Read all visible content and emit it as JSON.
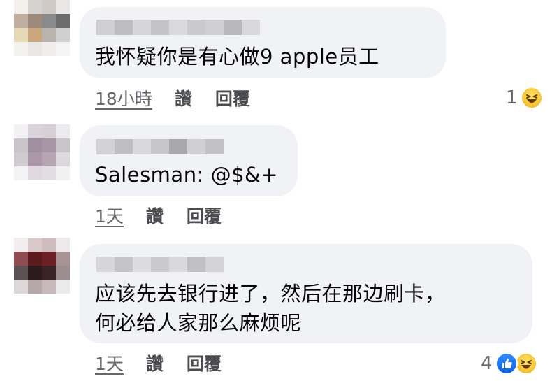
{
  "colors": {
    "bubble_bg": "#f0f2f5",
    "text": "#050505",
    "meta_text": "#65676b",
    "like_blue": "#1877f2",
    "haha_yellow": "#f7c633"
  },
  "comments": [
    {
      "text_lines": [
        "我怀疑你是有心做9 apple员工"
      ],
      "time": "18小時",
      "like_label": "讚",
      "reply_label": "回覆",
      "reaction_count": "1",
      "reactions": [
        "haha-icon"
      ]
    },
    {
      "text_lines": [
        "Salesman: @$&+"
      ],
      "time": "1天",
      "like_label": "讚",
      "reply_label": "回覆",
      "reaction_count": "",
      "reactions": []
    },
    {
      "text_lines": [
        "应该先去银行进了，然后在那边刷卡，",
        "何必给人家那么麻烦呢"
      ],
      "time": "1天",
      "like_label": "讚",
      "reply_label": "回覆",
      "reaction_count": "4",
      "reactions": [
        "like-icon",
        "haha-icon"
      ]
    }
  ]
}
